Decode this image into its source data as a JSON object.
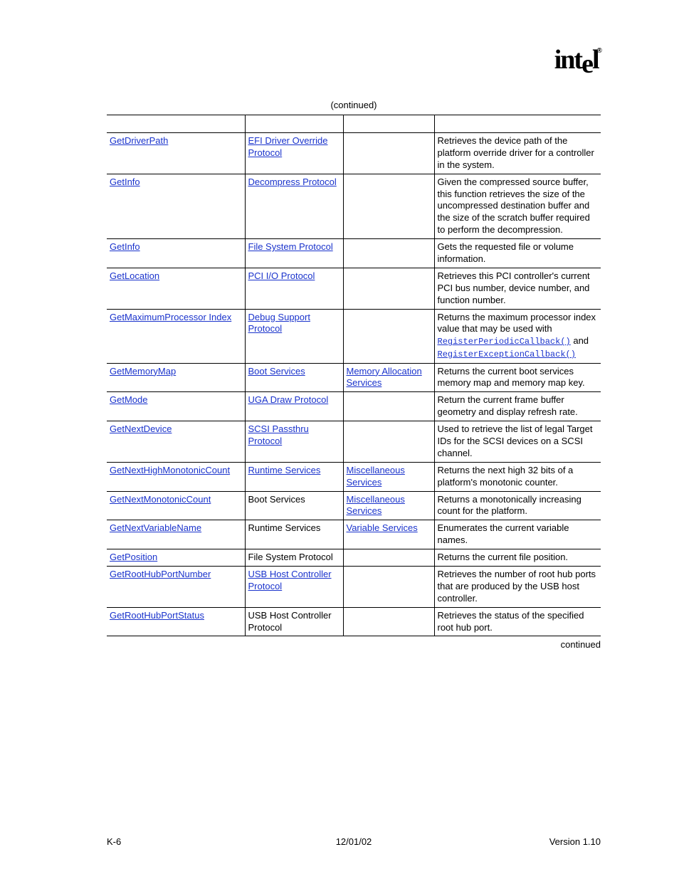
{
  "logo_text": "intel",
  "caption": "(continued)",
  "continued_note": "continued",
  "footer": {
    "left": "K-6",
    "center": "12/01/02",
    "right": "Version 1.10"
  },
  "rows": [
    {
      "func": {
        "text": "GetDriverPath",
        "link": true
      },
      "svc": {
        "text": "EFI Driver Override Protocol",
        "link": true
      },
      "sub": {
        "text": "",
        "link": false
      },
      "desc": [
        {
          "t": "text",
          "v": "Retrieves the device path of the platform override driver for a controller in the system."
        }
      ]
    },
    {
      "func": {
        "text": "GetInfo",
        "link": true
      },
      "svc": {
        "text": "Decompress Protocol",
        "link": true
      },
      "sub": {
        "text": "",
        "link": false
      },
      "desc": [
        {
          "t": "text",
          "v": "Given the compressed source buffer, this function retrieves the size of the uncompressed destination buffer and the size of the scratch buffer required to perform the decompression."
        }
      ]
    },
    {
      "func": {
        "text": "GetInfo",
        "link": true
      },
      "svc": {
        "text": "File System Protocol",
        "link": true
      },
      "sub": {
        "text": "",
        "link": false
      },
      "desc": [
        {
          "t": "text",
          "v": "Gets the requested file or volume information."
        }
      ]
    },
    {
      "func": {
        "text": "GetLocation",
        "link": true
      },
      "svc": {
        "text": "PCI I/O Protocol",
        "link": true
      },
      "sub": {
        "text": "",
        "link": false
      },
      "desc": [
        {
          "t": "text",
          "v": "Retrieves this PCI controller's current PCI bus number, device number, and function number."
        }
      ]
    },
    {
      "func": {
        "text": "GetMaximumProcessor Index",
        "link": true
      },
      "svc": {
        "text": "Debug Support Protocol",
        "link": true
      },
      "sub": {
        "text": "",
        "link": false
      },
      "desc": [
        {
          "t": "text",
          "v": "Returns the maximum processor index value that may be used with "
        },
        {
          "t": "code",
          "v": "RegisterPeriodicCallback()"
        },
        {
          "t": "text",
          "v": " and "
        },
        {
          "t": "code",
          "v": "RegisterExceptionCallback()"
        }
      ]
    },
    {
      "func": {
        "text": "GetMemoryMap",
        "link": true
      },
      "svc": {
        "text": "Boot Services",
        "link": true
      },
      "sub": {
        "text": "Memory Allocation Services",
        "link": true
      },
      "desc": [
        {
          "t": "text",
          "v": "Returns the current boot services memory map and memory map key."
        }
      ]
    },
    {
      "func": {
        "text": "GetMode",
        "link": true
      },
      "svc": {
        "text": "UGA Draw Protocol",
        "link": true
      },
      "sub": {
        "text": "",
        "link": false
      },
      "desc": [
        {
          "t": "text",
          "v": "Return the current frame buffer geometry and display refresh rate."
        }
      ]
    },
    {
      "func": {
        "text": "GetNextDevice",
        "link": true
      },
      "svc": {
        "text": "SCSI Passthru Protocol",
        "link": true
      },
      "sub": {
        "text": "",
        "link": false
      },
      "desc": [
        {
          "t": "text",
          "v": "Used to retrieve the list of legal Target IDs for the SCSI devices on a SCSI channel."
        }
      ]
    },
    {
      "func": {
        "text": "GetNextHighMonotonicCount",
        "link": true
      },
      "svc": {
        "text": "Runtime Services",
        "link": true
      },
      "sub": {
        "text": "Miscellaneous Services",
        "link": true
      },
      "desc": [
        {
          "t": "text",
          "v": "Returns the next high 32 bits of a platform's monotonic counter."
        }
      ]
    },
    {
      "func": {
        "text": "GetNextMonotonicCount",
        "link": true
      },
      "svc": {
        "text": "Boot Services",
        "link": false
      },
      "sub": {
        "text": "Miscellaneous Services",
        "link": true
      },
      "desc": [
        {
          "t": "text",
          "v": "Returns a monotonically increasing count for the platform."
        }
      ]
    },
    {
      "func": {
        "text": "GetNextVariableName",
        "link": true
      },
      "svc": {
        "text": "Runtime Services",
        "link": false
      },
      "sub": {
        "text": "Variable Services",
        "link": true
      },
      "desc": [
        {
          "t": "text",
          "v": "Enumerates the current variable names."
        }
      ]
    },
    {
      "func": {
        "text": "GetPosition",
        "link": true
      },
      "svc": {
        "text": "File System Protocol",
        "link": false
      },
      "sub": {
        "text": "",
        "link": false
      },
      "desc": [
        {
          "t": "text",
          "v": "Returns the current file position."
        }
      ]
    },
    {
      "func": {
        "text": "GetRootHubPortNumber",
        "link": true
      },
      "svc": {
        "text": "USB Host Controller Protocol",
        "link": true
      },
      "sub": {
        "text": "",
        "link": false
      },
      "desc": [
        {
          "t": "text",
          "v": "Retrieves the number of root hub ports that are produced by the USB host controller."
        }
      ]
    },
    {
      "func": {
        "text": "GetRootHubPortStatus",
        "link": true
      },
      "svc": {
        "text": "USB Host Controller Protocol",
        "link": false
      },
      "sub": {
        "text": "",
        "link": false
      },
      "desc": [
        {
          "t": "text",
          "v": "Retrieves the status of the specified root hub port."
        }
      ]
    }
  ]
}
